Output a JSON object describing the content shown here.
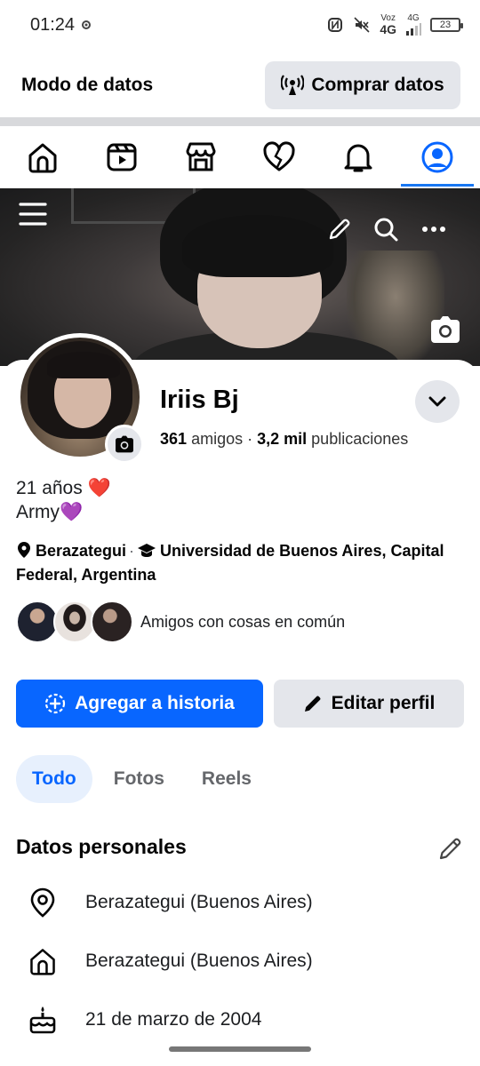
{
  "status_bar": {
    "time": "01:24",
    "network_top": "Voz",
    "network_gen": "4G",
    "network_small": "4G",
    "battery": "23"
  },
  "data_bar": {
    "title": "Modo de datos",
    "buy_label": "Comprar datos"
  },
  "nav": {
    "items": [
      "home-icon",
      "video-icon",
      "marketplace-icon",
      "dating-heart-icon",
      "notifications-bell-icon",
      "profile-icon"
    ],
    "active": "profile-icon"
  },
  "cover": {
    "icons": [
      "menu-icon",
      "pencil-icon",
      "search-icon",
      "more-icon",
      "camera-icon"
    ]
  },
  "profile": {
    "name": "Iriis Bj",
    "friends_count": "361",
    "friends_label": "amigos",
    "separator": "·",
    "posts_count": "3,2 mil",
    "posts_label": "publicaciones",
    "bio_line1": "21 años ❤️",
    "bio_line2": "Army💜",
    "city": "Berazategui",
    "university": "Universidad de Buenos Aires, Capital Federal, Argentina",
    "mutual_text": "Amigos con cosas en común"
  },
  "actions": {
    "add_story": "Agregar a historia",
    "edit_profile": "Editar perfil"
  },
  "tabs": [
    {
      "label": "Todo",
      "active": true
    },
    {
      "label": "Fotos",
      "active": false
    },
    {
      "label": "Reels",
      "active": false
    }
  ],
  "personal": {
    "title": "Datos personales",
    "items": [
      {
        "icon": "location-pin-icon",
        "text": "Berazategui (Buenos Aires)"
      },
      {
        "icon": "home-icon",
        "text": "Berazategui (Buenos Aires)"
      },
      {
        "icon": "birthday-cake-icon",
        "text": "21 de marzo de 2004"
      }
    ]
  },
  "colors": {
    "accent": "#0866ff",
    "secondary_button": "#e4e6eb",
    "active_tab_bg": "#e7f0fd"
  }
}
